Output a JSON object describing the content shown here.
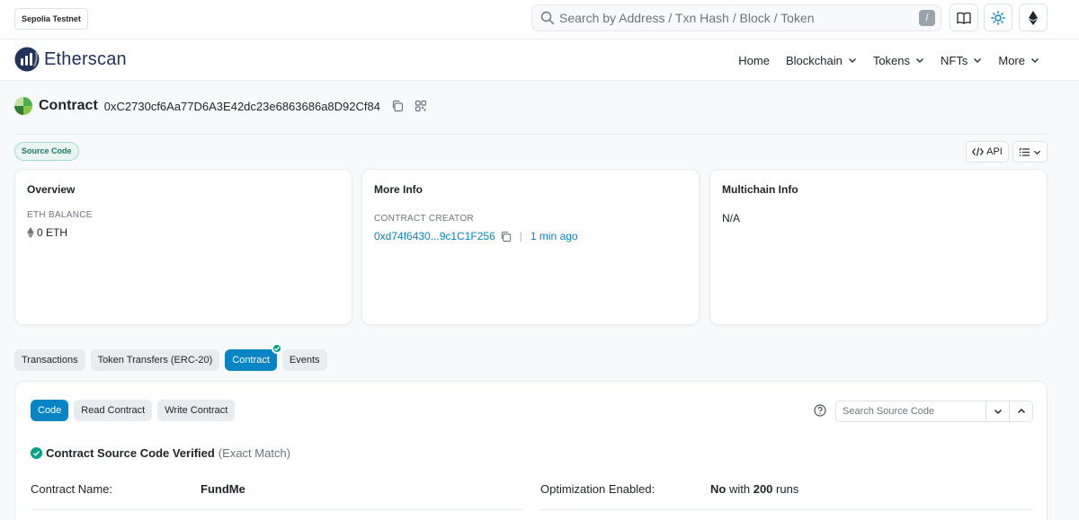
{
  "topbar": {
    "network": "Sepolia Testnet",
    "search_placeholder": "Search by Address / Txn Hash / Block / Token",
    "slash_key": "/"
  },
  "nav": {
    "brand": "Etherscan",
    "items": [
      {
        "label": "Home"
      },
      {
        "label": "Blockchain"
      },
      {
        "label": "Tokens"
      },
      {
        "label": "NFTs"
      },
      {
        "label": "More"
      }
    ]
  },
  "contract": {
    "title": "Contract",
    "address": "0xC2730cf6Aa77D6A3E42dc23e6863686a8D92Cf84"
  },
  "badges": {
    "source_code": "Source Code",
    "api": "API"
  },
  "overview": {
    "title": "Overview",
    "eth_balance_label": "ETH BALANCE",
    "eth_balance_value": "0 ETH"
  },
  "more_info": {
    "title": "More Info",
    "creator_label": "CONTRACT CREATOR",
    "creator_address": "0xd74f6430...9c1C1F256",
    "separator": "|",
    "creator_time": "1 min ago"
  },
  "multichain": {
    "title": "Multichain Info",
    "value": "N/A"
  },
  "tabs": [
    {
      "label": "Transactions"
    },
    {
      "label": "Token Transfers (ERC-20)"
    },
    {
      "label": "Contract"
    },
    {
      "label": "Events"
    }
  ],
  "code_panel": {
    "sub_tabs": [
      {
        "label": "Code"
      },
      {
        "label": "Read Contract"
      },
      {
        "label": "Write Contract"
      }
    ],
    "search_placeholder": "Search Source Code",
    "verified_text": "Contract Source Code Verified",
    "verified_note": "(Exact Match)",
    "contract_name_label": "Contract Name:",
    "contract_name_value": "FundMe",
    "optimization_label": "Optimization Enabled:",
    "optimization_no": "No",
    "optimization_with": "with",
    "optimization_runs": "200",
    "optimization_runs_word": "runs"
  },
  "colors": {
    "accent": "#0784c3",
    "brand_navy": "#21325b",
    "verified_green": "#00a186"
  },
  "icons": [
    "search-icon",
    "book-icon",
    "sun-icon",
    "ethereum-icon",
    "copy-icon",
    "qr-code-icon",
    "code-icon",
    "list-filter-icon",
    "chevron-down-icon",
    "chevron-up-icon",
    "help-icon",
    "check-circle-icon"
  ]
}
